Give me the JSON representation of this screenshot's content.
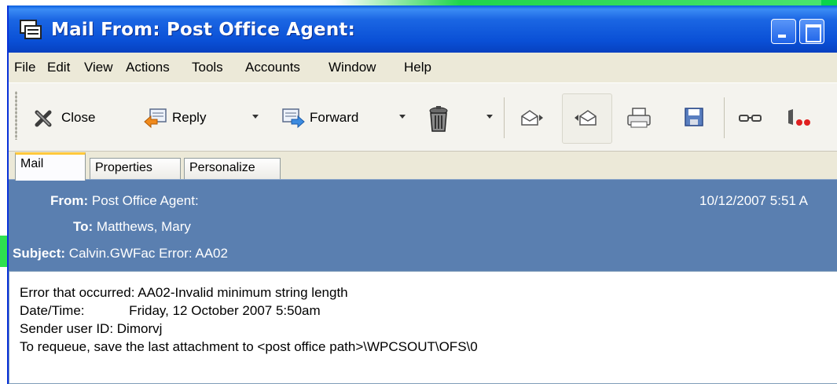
{
  "window": {
    "title": "Mail From: Post Office Agent:"
  },
  "menu": [
    "File",
    "Edit",
    "View",
    "Actions",
    "Tools",
    "Accounts",
    "Window",
    "Help"
  ],
  "toolbar": {
    "close_label": "Close",
    "reply_label": "Reply",
    "forward_label": "Forward",
    "icons": [
      "close-icon",
      "reply-icon",
      "forward-icon",
      "trash-icon",
      "previous-message-icon",
      "next-message-icon",
      "print-icon",
      "save-icon",
      "glasses-icon",
      "phone-icon"
    ]
  },
  "tabs": [
    "Mail",
    "Properties",
    "Personalize"
  ],
  "header": {
    "from_label": "From:",
    "from_value": "Post Office Agent:",
    "date_value": "10/12/2007 5:51 A",
    "to_label": "To:",
    "to_value": "Matthews, Mary",
    "subject_label": "Subject:",
    "subject_value": "Calvin.GWFac Error:  AA02"
  },
  "body": {
    "lines": [
      "Error that occurred: AA02-Invalid minimum string length",
      "Date/Time:            Friday, 12 October 2007 5:50am",
      "Sender user ID: Dimorvj",
      "To requeue, save the last attachment to <post office path>\\WPCSOUT\\OFS\\0"
    ]
  },
  "colors": {
    "title_bar": "#1b66e3",
    "header_background": "#5a7fb0",
    "desktop_green": "#0bd34a"
  }
}
